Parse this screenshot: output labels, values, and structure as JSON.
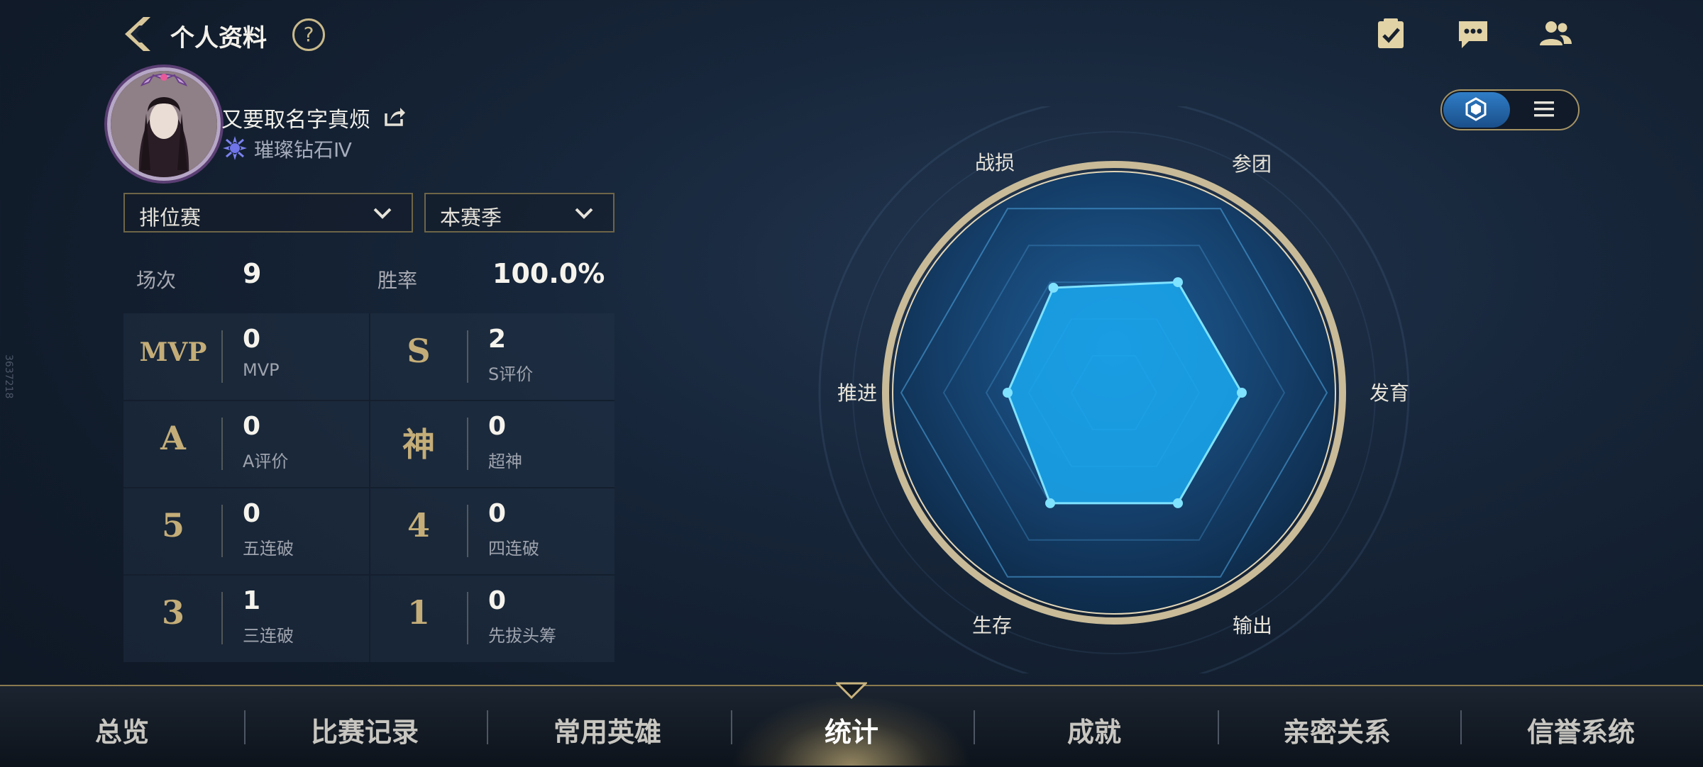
{
  "header": {
    "title": "个人资料",
    "help_label": "?",
    "icons": [
      "back-arrow-icon",
      "help-icon",
      "task-checklist-icon",
      "chat-message-icon",
      "friends-icon"
    ]
  },
  "profile": {
    "username": "又要取名字真烦",
    "rank": "璀璨钻石Ⅳ"
  },
  "filters": {
    "mode": "排位赛",
    "season": "本赛季"
  },
  "summary": {
    "matches_label": "场次",
    "matches_value": "9",
    "winrate_label": "胜率",
    "winrate_value": "100.0%"
  },
  "stats": [
    {
      "icon": "MVP",
      "value": "0",
      "label": "MVP"
    },
    {
      "icon": "S",
      "value": "2",
      "label": "S评价"
    },
    {
      "icon": "A",
      "value": "0",
      "label": "A评价"
    },
    {
      "icon": "神",
      "value": "0",
      "label": "超神"
    },
    {
      "icon": "5",
      "value": "0",
      "label": "五连破"
    },
    {
      "icon": "4",
      "value": "0",
      "label": "四连破"
    },
    {
      "icon": "3",
      "value": "1",
      "label": "三连破"
    },
    {
      "icon": "1",
      "value": "0",
      "label": "先拔头筹"
    }
  ],
  "side_text": "3637218",
  "radar": {
    "labels": {
      "top_left": "战损",
      "top_right": "参团",
      "right": "发育",
      "bottom_right": "输出",
      "bottom_left": "生存",
      "left": "推进"
    },
    "values": {
      "战损": 0.57,
      "参团": 0.6,
      "发育": 0.6,
      "输出": 0.6,
      "生存": 0.6,
      "推进": 0.5
    },
    "colors": {
      "fill": "#1aa8f0",
      "stroke": "#7fe2ff",
      "ring": "#c9bb98"
    }
  },
  "view_toggle": {
    "active": "radar",
    "icons": [
      "hexagon-icon",
      "list-icon"
    ]
  },
  "nav": {
    "tabs": [
      "总览",
      "比赛记录",
      "常用英雄",
      "统计",
      "成就",
      "亲密关系",
      "信誉系统"
    ],
    "active_index": 3
  }
}
